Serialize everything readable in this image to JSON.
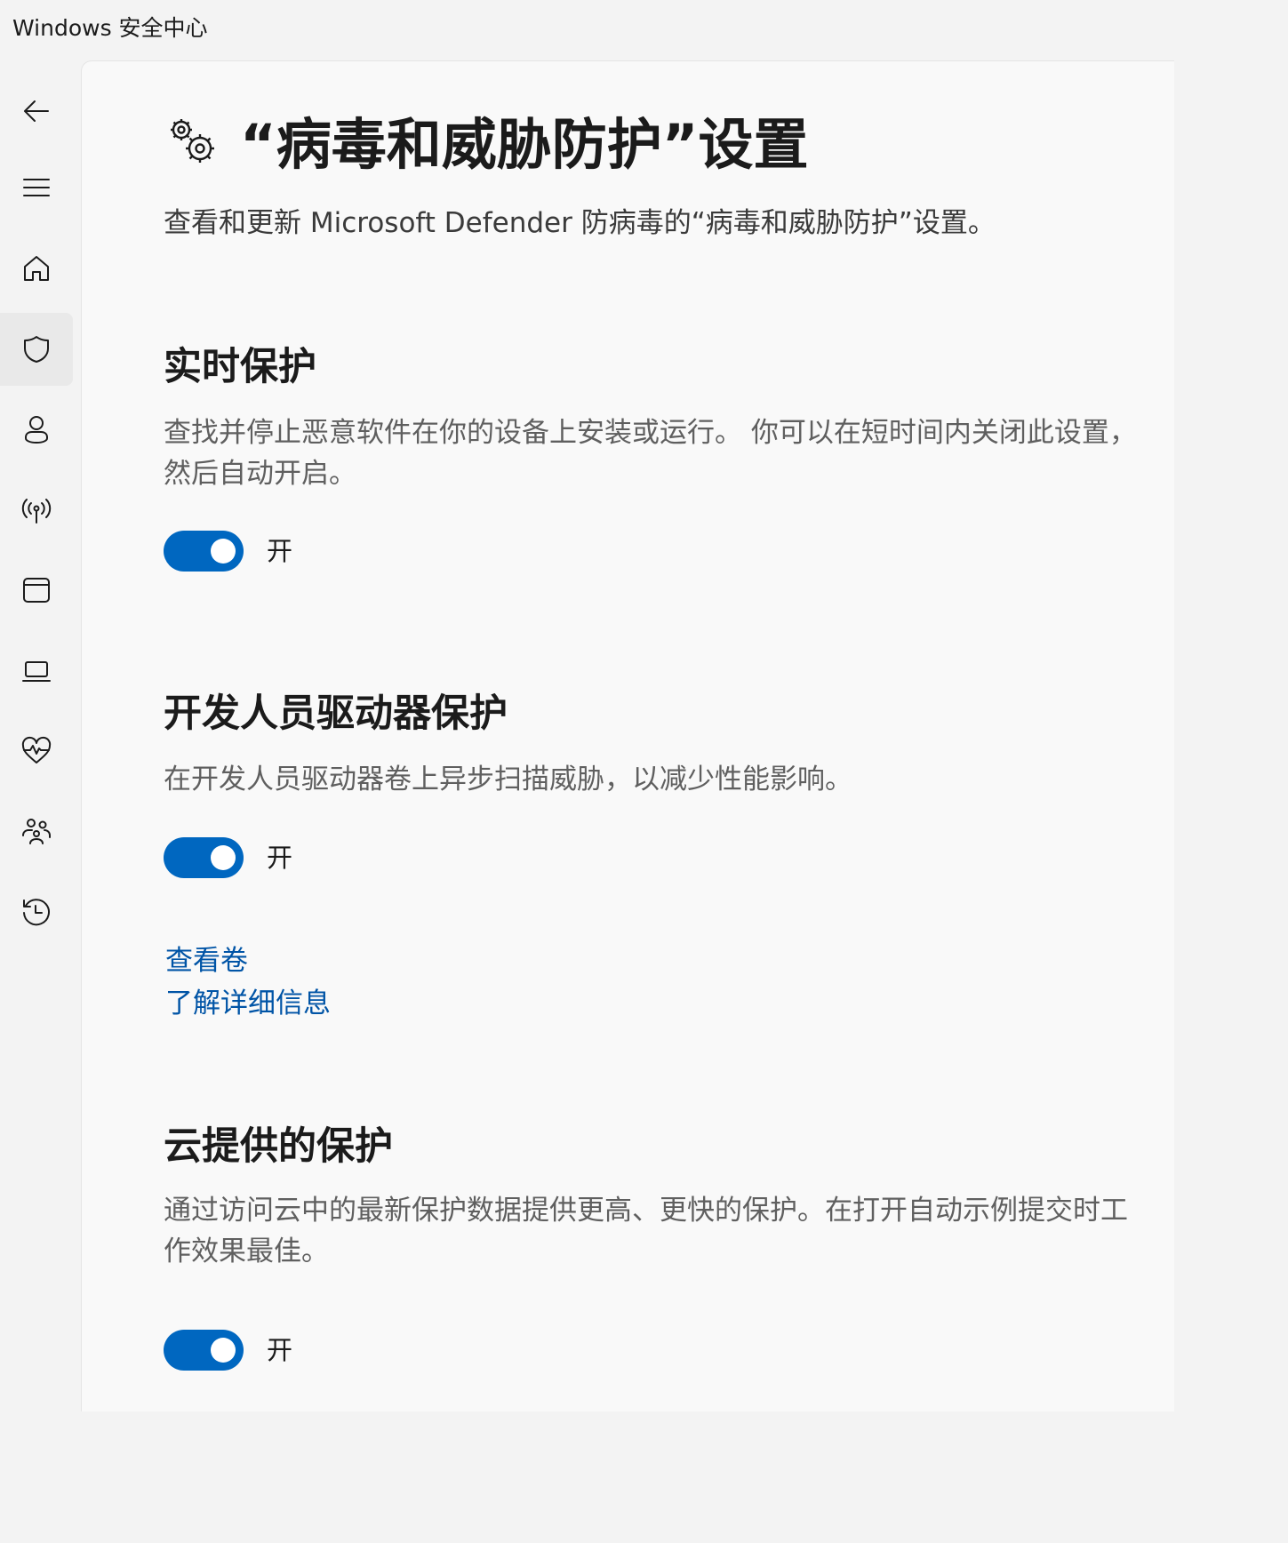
{
  "app": {
    "title": "Windows 安全中心"
  },
  "nav": {
    "items": [
      {
        "id": "back",
        "icon": "back-arrow-icon"
      },
      {
        "id": "menu",
        "icon": "hamburger-menu-icon"
      },
      {
        "id": "home",
        "icon": "home-icon"
      },
      {
        "id": "virus-protection",
        "icon": "shield-icon",
        "active": true
      },
      {
        "id": "account-protection",
        "icon": "person-icon"
      },
      {
        "id": "firewall-network",
        "icon": "wireless-signal-icon"
      },
      {
        "id": "app-browser-control",
        "icon": "browser-window-icon"
      },
      {
        "id": "device-security",
        "icon": "laptop-icon"
      },
      {
        "id": "device-performance",
        "icon": "heart-pulse-icon"
      },
      {
        "id": "family-options",
        "icon": "family-icon"
      },
      {
        "id": "protection-history",
        "icon": "history-icon"
      }
    ]
  },
  "page": {
    "icon": "gears-icon",
    "title": "“病毒和威胁防护”设置",
    "subtitle": "查看和更新 Microsoft Defender 防病毒的“病毒和威胁防护”设置。"
  },
  "sections": [
    {
      "title": "实时保护",
      "description": "查找并停止恶意软件在你的设备上安装或运行。 你可以在短时间内关闭此设置，然后自动开启。",
      "toggle": {
        "on": true,
        "label": "开"
      }
    },
    {
      "title": "开发人员驱动器保护",
      "description": "在开发人员驱动器卷上异步扫描威胁，以减少性能影响。",
      "toggle": {
        "on": true,
        "label": "开"
      },
      "links": [
        "查看卷",
        "了解详细信息"
      ]
    },
    {
      "title": "云提供的保护",
      "description": "通过访问云中的最新保护数据提供更高、更快的保护。在打开自动示例提交时工作效果最佳。",
      "toggle": {
        "on": true,
        "label": "开"
      }
    }
  ],
  "colors": {
    "accent": "#0067c0",
    "link": "#0054a6",
    "window_bg": "#f3f3f3",
    "content_bg": "#f9f9f9"
  }
}
